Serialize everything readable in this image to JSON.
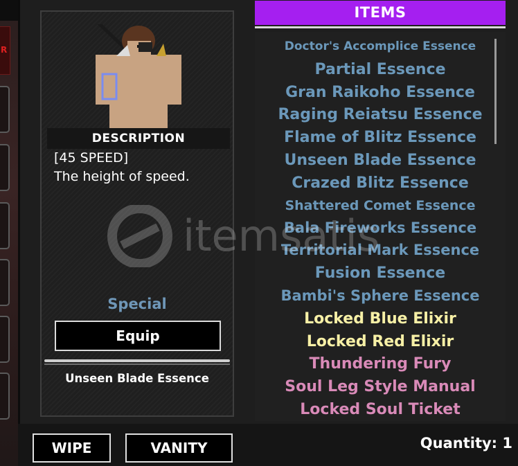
{
  "detail": {
    "description_title": "DESCRIPTION",
    "description_lines": [
      "[45 SPEED]",
      "The height of speed."
    ],
    "rarity": "Special",
    "equip_label": "Equip",
    "item_name": "Unseen Blade Essence"
  },
  "items_panel": {
    "title": "ITEMS",
    "items": [
      {
        "name": "Doctor's Accomplice Essence",
        "color": "#6b98ba"
      },
      {
        "name": "Partial Essence",
        "color": "#6b98ba"
      },
      {
        "name": "Gran Raikoho Essence",
        "color": "#6b98ba"
      },
      {
        "name": "Raging Reiatsu Essence",
        "color": "#6b98ba"
      },
      {
        "name": "Flame of Blitz Essence",
        "color": "#6b98ba"
      },
      {
        "name": "Unseen Blade Essence",
        "color": "#6b98ba"
      },
      {
        "name": "Crazed Blitz Essence",
        "color": "#6b98ba"
      },
      {
        "name": "Shattered Comet Essence",
        "color": "#6b98ba"
      },
      {
        "name": "Bala Fireworks Essence",
        "color": "#6b98ba"
      },
      {
        "name": "Territorial Mark Essence",
        "color": "#6b98ba"
      },
      {
        "name": "Fusion Essence",
        "color": "#6b98ba"
      },
      {
        "name": "Bambi's Sphere Essence",
        "color": "#6b98ba"
      },
      {
        "name": "Locked Blue Elixir",
        "color": "#f7f0a6"
      },
      {
        "name": "Locked Red Elixir",
        "color": "#f7f0a6"
      },
      {
        "name": "Thundering Fury",
        "color": "#d98ab8"
      },
      {
        "name": "Soul Leg Style Manual",
        "color": "#d98ab8"
      },
      {
        "name": "Locked Soul Ticket",
        "color": "#d98ab8"
      }
    ]
  },
  "bottom": {
    "wipe_label": "WIPE",
    "vanity_label": "VANITY",
    "quantity_text": "Quantity: 1"
  },
  "watermark": {
    "text": "itemsatis"
  },
  "sidebar": {
    "marker_text": "R"
  }
}
